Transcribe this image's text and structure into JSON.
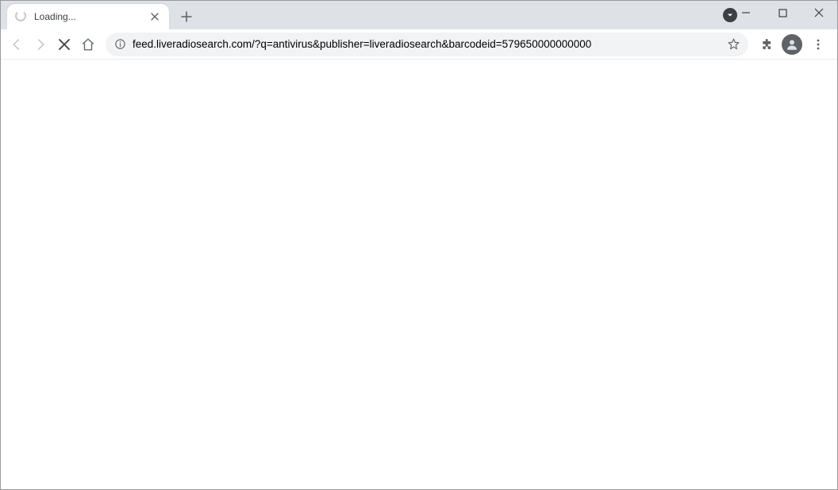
{
  "tab": {
    "title": "Loading...",
    "loading": true
  },
  "url": {
    "host": "feed.liveradiosearch.com",
    "path": "/?q=antivirus&publisher=liveradiosearch&barcodeid=579650000000000"
  },
  "icons": {
    "back": "back-icon",
    "forward": "forward-icon",
    "stop": "stop-icon",
    "home": "home-icon",
    "info": "info-icon",
    "bookmark": "star-icon",
    "extensions": "extensions-icon",
    "profile": "profile-icon",
    "menu": "menu-icon",
    "newtab": "plus-icon",
    "close": "close-icon",
    "minimize": "minimize-icon",
    "maximize": "maximize-icon",
    "closewin": "closewin-icon",
    "tray": "tray-icon"
  }
}
